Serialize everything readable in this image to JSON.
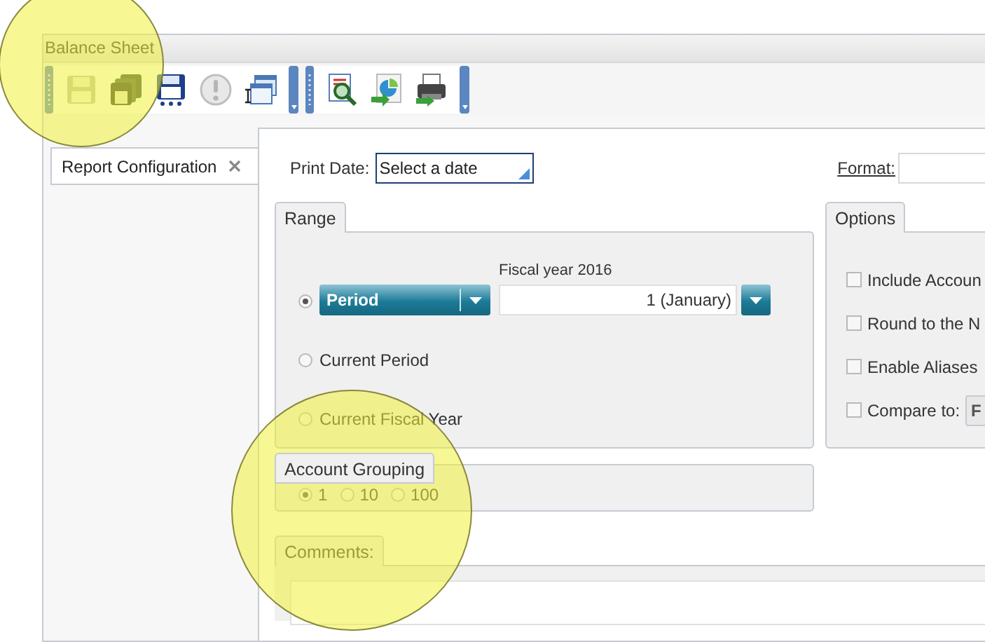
{
  "window": {
    "title": "Balance Sheet"
  },
  "toolbar": {
    "groups": [
      {
        "items": [
          {
            "kind": "floppy",
            "disabled": true
          },
          {
            "kind": "floppies",
            "disabled": false
          },
          {
            "kind": "floppy-dots",
            "disabled": false
          },
          {
            "kind": "alert",
            "disabled": true
          },
          {
            "kind": "window",
            "disabled": false
          }
        ]
      },
      {
        "items": [
          {
            "kind": "magnifier",
            "disabled": false
          },
          {
            "kind": "chart-arrow",
            "disabled": false
          },
          {
            "kind": "printer",
            "disabled": false
          }
        ]
      }
    ]
  },
  "tabs": [
    {
      "label": "Report Configuration",
      "selected": true,
      "closable": true
    }
  ],
  "print_date": {
    "label": "Print Date:",
    "placeholder": "Select a date"
  },
  "format": {
    "label": "Format:"
  },
  "range": {
    "title": "Range",
    "options": [
      {
        "kind": "dropdown",
        "label": "Period",
        "selected": true,
        "caption": "Fiscal year 2016",
        "value": "1 (January)"
      },
      {
        "kind": "plain",
        "label": "Current Period",
        "selected": false
      },
      {
        "kind": "plain",
        "label": "Current Fiscal Year",
        "selected": false
      }
    ]
  },
  "options": {
    "title": "Options",
    "items": [
      {
        "kind": "check",
        "label": "Include Accoun",
        "checked": false
      },
      {
        "kind": "check",
        "label": "Round to the N",
        "checked": false
      },
      {
        "kind": "check",
        "label": "Enable Aliases",
        "checked": false
      },
      {
        "kind": "compare",
        "label": "Compare to:",
        "checked": false,
        "value": "F"
      }
    ]
  },
  "account_grouping": {
    "title": "Account Grouping",
    "options": [
      {
        "label": "1",
        "selected": true
      },
      {
        "label": "10",
        "selected": false
      },
      {
        "label": "100",
        "selected": false
      }
    ]
  },
  "comments": {
    "title": "Comments:"
  }
}
